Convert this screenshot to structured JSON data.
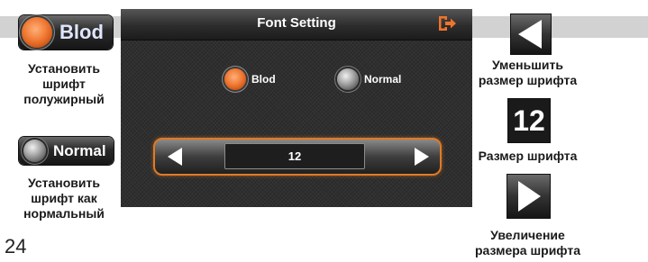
{
  "legend_left": {
    "bold_icon": {
      "label": "Blod",
      "icon": "radio-selected-icon"
    },
    "bold_caption": [
      "Установить",
      "шрифт",
      "полужирный"
    ],
    "normal_icon": {
      "label": "Normal",
      "icon": "radio-unselected-icon"
    },
    "normal_caption": [
      "Установить",
      "шрифт как",
      "нормальный"
    ]
  },
  "page_number": "24",
  "screen": {
    "title": "Font Setting",
    "exit_icon": "exit-icon",
    "options": [
      {
        "label": "Blod",
        "selected": true
      },
      {
        "label": "Normal",
        "selected": false
      }
    ],
    "font_size": "12",
    "decrease_icon": "chevron-left-icon",
    "increase_icon": "chevron-right-icon"
  },
  "legend_right": {
    "decrease_caption": [
      "Уменьшить",
      "размер шрифта"
    ],
    "size_icon_value": "12",
    "size_caption": [
      "Размер шрифта"
    ],
    "increase_caption": [
      "Увеличение",
      "размера шрифта"
    ]
  },
  "colors": {
    "accent_orange": "#f07a34",
    "screen_bg": "#2f2f2f",
    "band_gray": "#d2d2d2"
  }
}
